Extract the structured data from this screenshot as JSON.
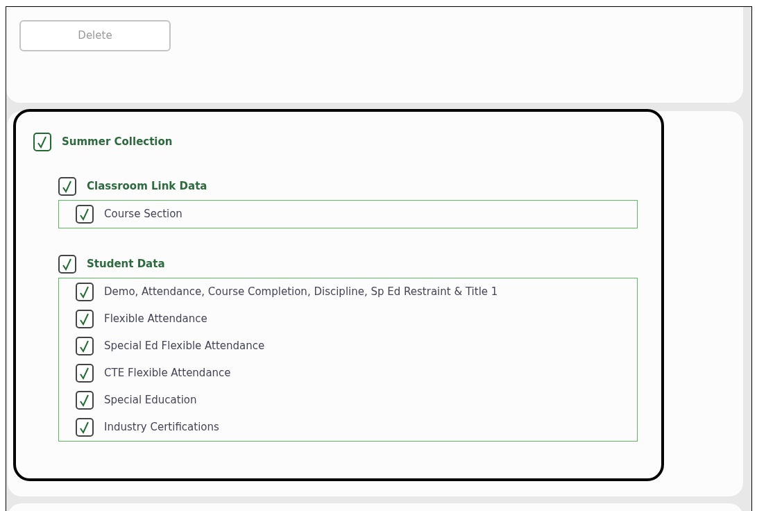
{
  "delete_button": {
    "label": "Delete",
    "disabled": true
  },
  "collection": {
    "label": "Summer Collection",
    "checked": true,
    "children": [
      {
        "label": "Classroom Link Data",
        "checked": true,
        "children": [
          {
            "label": "Course Section",
            "checked": true
          }
        ]
      },
      {
        "label": "Student Data",
        "checked": true,
        "children": [
          {
            "label": "Demo, Attendance, Course Completion, Discipline, Sp Ed Restraint & Title 1",
            "checked": true
          },
          {
            "label": "Flexible Attendance",
            "checked": true
          },
          {
            "label": "Special Ed Flexible Attendance",
            "checked": true
          },
          {
            "label": "CTE Flexible Attendance",
            "checked": true
          },
          {
            "label": "Special Education",
            "checked": true
          },
          {
            "label": "Industry Certifications",
            "checked": true
          }
        ]
      }
    ]
  }
}
